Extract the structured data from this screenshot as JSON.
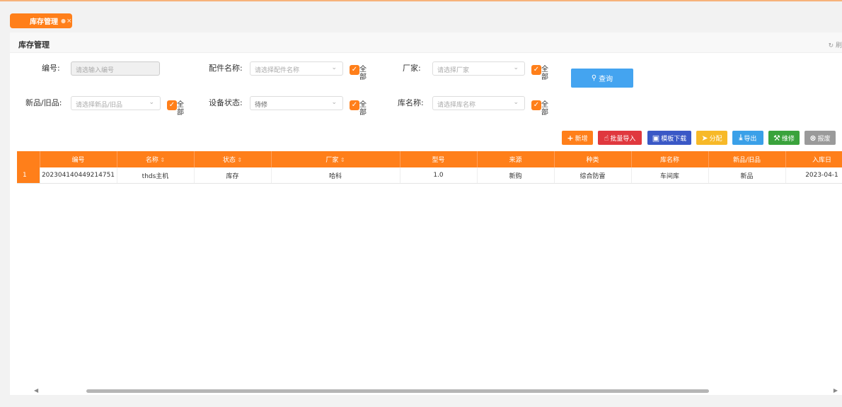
{
  "tab": {
    "label": "库存管理"
  },
  "panel": {
    "title": "库存管理",
    "refresh_label": "刷"
  },
  "form": {
    "code": {
      "label": "编号:",
      "placeholder": "请选输入编号"
    },
    "part_name": {
      "label": "配件名称:",
      "placeholder": "请选择配件名称"
    },
    "manufacturer": {
      "label": "厂家:",
      "placeholder": "请选择厂家"
    },
    "new_old": {
      "label": "新品/旧品:",
      "placeholder": "请选择新品/旧品"
    },
    "device_status": {
      "label": "设备状态:",
      "value": "待修"
    },
    "warehouse": {
      "label": "库名称:",
      "placeholder": "请选择库名称"
    },
    "all_checkbox_label_1": "全",
    "all_checkbox_label_2": "部",
    "query_button": "查询"
  },
  "toolbar": {
    "add": "新增",
    "batch_import": "批量导入",
    "template_download": "模板下载",
    "assign": "分配",
    "export": "导出",
    "repair": "维修",
    "scrap": "报废"
  },
  "table": {
    "columns": [
      "",
      "编号",
      "名称",
      "状态",
      "厂家",
      "型号",
      "来源",
      "种类",
      "库名称",
      "新品/旧品",
      "入库日"
    ],
    "sortable": [
      false,
      false,
      true,
      true,
      true,
      false,
      false,
      false,
      false,
      false,
      false
    ],
    "rows": [
      [
        "1",
        "202304140449214751",
        "thds主机",
        "库存",
        "哈科",
        "1.0",
        "新购",
        "综合防雷",
        "车间库",
        "新品",
        "2023-04-1"
      ]
    ]
  },
  "colors": {
    "accent": "#ff7f1a",
    "query": "#44a4f0"
  }
}
